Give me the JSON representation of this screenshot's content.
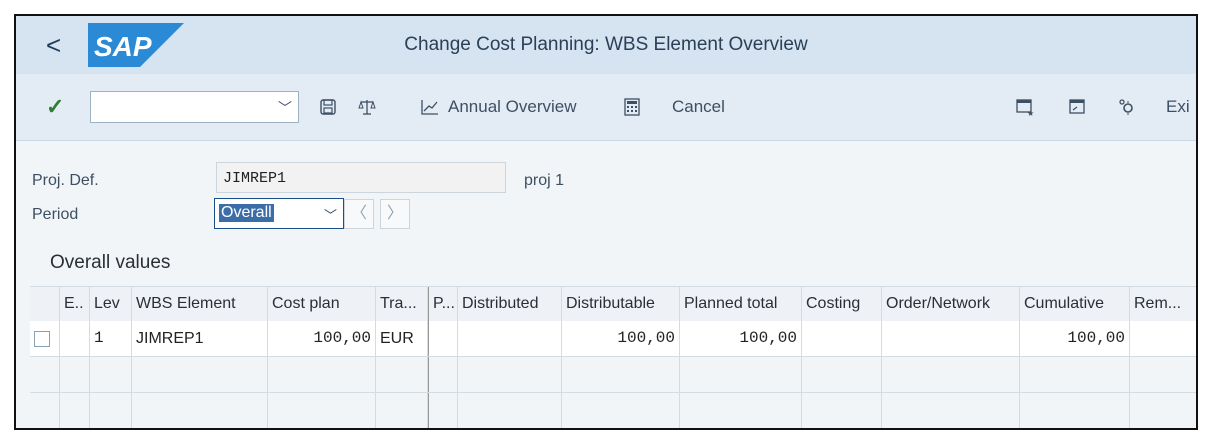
{
  "titlebar": {
    "back_label": "<",
    "logo_text": "SAP",
    "title": "Change Cost Planning: WBS Element Overview"
  },
  "toolbar": {
    "confirm_icon": "checkmark-icon",
    "command_field_value": "",
    "annual_overview_label": "Annual Overview",
    "cancel_label": "Cancel",
    "exit_label": "Exi",
    "icons": [
      "save-icon",
      "balance-icon",
      "chart-icon",
      "calculator-icon",
      "create-session-icon",
      "open-session-icon",
      "settings-icon"
    ]
  },
  "header_fields": {
    "proj_def_label": "Proj. Def.",
    "proj_def_value": "JIMREP1",
    "proj_def_desc": "proj 1",
    "period_label": "Period",
    "period_value": "Overall"
  },
  "section_title": "Overall values",
  "table": {
    "columns": [
      "E..",
      "Lev",
      "WBS Element",
      "Cost plan",
      "Tra...",
      "P...",
      "Distributed",
      "Distributable",
      "Planned total",
      "Costing",
      "Order/Network",
      "Cumulative",
      "Rem..."
    ],
    "rows": [
      {
        "E": "",
        "Lev": "1",
        "WBS Element": "JIMREP1",
        "Cost plan": "100,00",
        "Tra": "EUR",
        "P": "",
        "Distributed": "",
        "Distributable": "100,00",
        "Planned total": "100,00",
        "Costing": "",
        "Order/Network": "",
        "Cumulative": "100,00",
        "Rem": ""
      }
    ]
  }
}
